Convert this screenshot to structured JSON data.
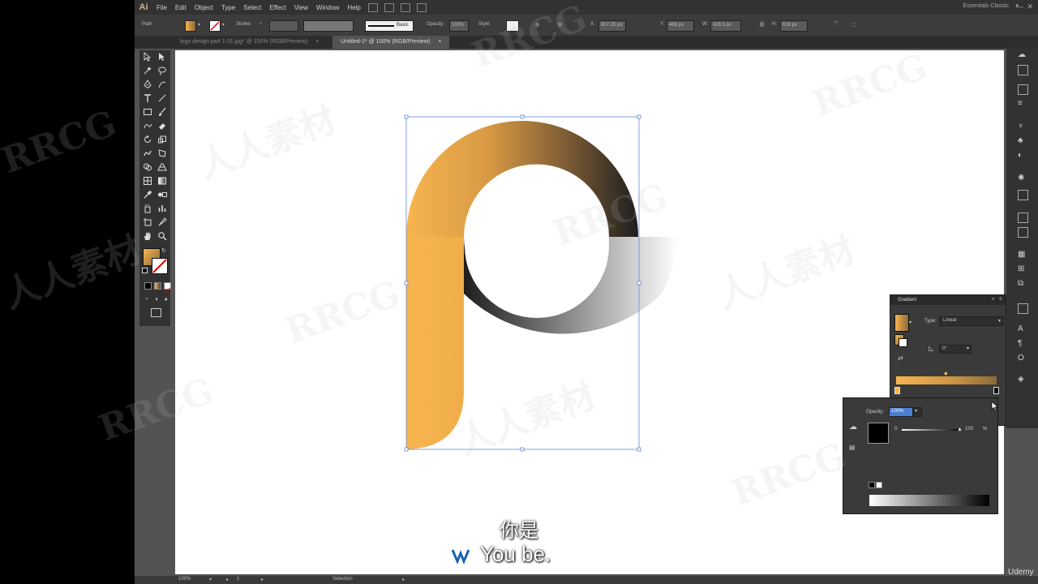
{
  "app": {
    "logo": "Ai",
    "menu": [
      "File",
      "Edit",
      "Object",
      "Type",
      "Select",
      "Effect",
      "View",
      "Window",
      "Help"
    ],
    "workspace": "Essentials Classic"
  },
  "control": {
    "selection_type": "Path",
    "stroke_label": "Stroke:",
    "brush_label": "Basic",
    "opacity_label": "Opacity:",
    "opacity_value": "100%",
    "style_label": "Style:",
    "x_label": "X:",
    "x_value": "807.25 px",
    "y_label": "Y:",
    "y_value": "466 px",
    "w_label": "W:",
    "w_value": "428.5 px",
    "h_label": "H:",
    "h_value": "616 px"
  },
  "tabs": [
    {
      "label": "logo design part 1-01.jpg* @ 150% (RGB/Preview)"
    },
    {
      "label": "Untitled-1* @ 100% (RGB/Preview)"
    }
  ],
  "tab_close": "×",
  "gradient_panel": {
    "title": "Gradient",
    "type_label": "Type:",
    "type_value": "Linear",
    "angle_value": "0°"
  },
  "opacity_popup": {
    "label": "Opacity:",
    "value": "100%",
    "slider_min": "0",
    "slider_max": "100",
    "slider_unit": "%",
    "level": 1.0
  },
  "status": {
    "zoom": "100%",
    "page": "1",
    "mode": "Selection"
  },
  "subtitles": {
    "chinese": "你是",
    "english": "You be."
  },
  "brand": "Udemy",
  "watermarks": {
    "rrcg": "RRCG",
    "cn": "人人素材"
  },
  "colors": {
    "gold": "#F7B44E",
    "dark": "#2a2a2a",
    "selection": "#6a86d6"
  }
}
